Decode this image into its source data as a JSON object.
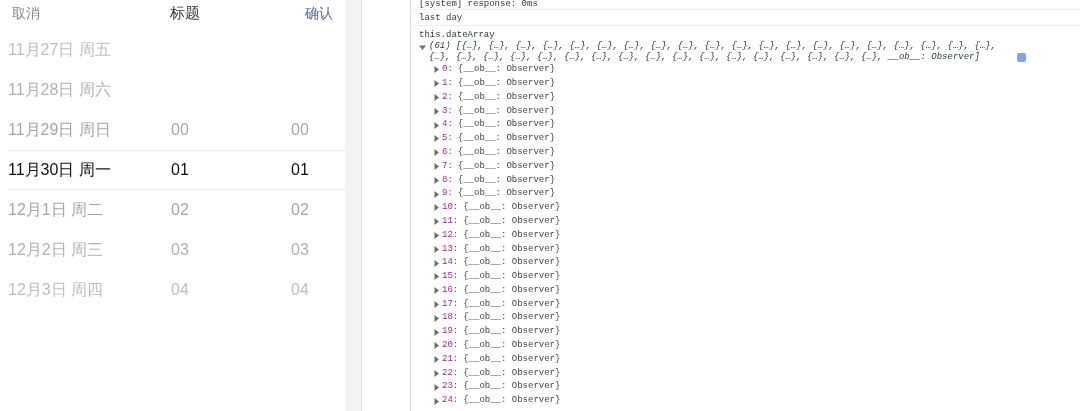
{
  "picker": {
    "cancel": "取消",
    "title": "标题",
    "confirm": "确认",
    "rows": [
      {
        "date": "11月27日 周五",
        "hour": "",
        "minute": "",
        "selected": false
      },
      {
        "date": "11月28日 周六",
        "hour": "",
        "minute": "",
        "selected": false
      },
      {
        "date": "11月29日 周日",
        "hour": "00",
        "minute": "00",
        "selected": false
      },
      {
        "date": "11月30日 周一",
        "hour": "01",
        "minute": "01",
        "selected": true
      },
      {
        "date": "12月1日 周二",
        "hour": "02",
        "minute": "02",
        "selected": false
      },
      {
        "date": "12月2日 周三",
        "hour": "03",
        "minute": "03",
        "selected": false
      },
      {
        "date": "12月3日 周四",
        "hour": "04",
        "minute": "04",
        "selected": false
      }
    ]
  },
  "console": {
    "messages": [
      {
        "text": "[system] response: 0ms"
      },
      {
        "text": "last day"
      }
    ],
    "log": {
      "label": "this.dateArray",
      "summary": "(61) [{…}, {…}, {…}, {…}, {…}, {…}, {…}, {…}, {…}, {…}, {…}, {…}, {…}, {…}, {…}, {…}, {…}, {…}, {…}, {…}, {…}, {…}, {…}, {…}, {…}, {…}, {…}, {…}, {…}, {…}, {…}, {…}, {…}, {…}, {…}, {…}, {…}, __ob__: Observer]",
      "expanded": true,
      "entries": [
        {
          "key": "0:",
          "value": "{__ob__: Observer}",
          "expanded": false
        },
        {
          "key": "1:",
          "value": "{__ob__: Observer}",
          "expanded": false
        },
        {
          "key": "2:",
          "value": "{__ob__: Observer}",
          "expanded": false
        },
        {
          "key": "3:",
          "value": "{__ob__: Observer}",
          "expanded": false
        },
        {
          "key": "4:",
          "value": "{__ob__: Observer}",
          "expanded": false
        },
        {
          "key": "5:",
          "value": "{__ob__: Observer}",
          "expanded": false
        },
        {
          "key": "6:",
          "value": "{__ob__: Observer}",
          "expanded": false
        },
        {
          "key": "7:",
          "value": "{__ob__: Observer}",
          "expanded": false
        },
        {
          "key": "8:",
          "value": "{__ob__: Observer}",
          "expanded": false
        },
        {
          "key": "9:",
          "value": "{__ob__: Observer}",
          "expanded": false
        },
        {
          "key": "10:",
          "value": "{__ob__: Observer}",
          "expanded": false
        },
        {
          "key": "11:",
          "value": "{__ob__: Observer}",
          "expanded": false
        },
        {
          "key": "12:",
          "value": "{__ob__: Observer}",
          "expanded": false
        },
        {
          "key": "13:",
          "value": "{__ob__: Observer}",
          "expanded": false
        },
        {
          "key": "14:",
          "value": "{__ob__: Observer}",
          "expanded": false
        },
        {
          "key": "15:",
          "value": "{__ob__: Observer}",
          "expanded": false
        },
        {
          "key": "16:",
          "value": "{__ob__: Observer}",
          "expanded": false
        },
        {
          "key": "17:",
          "value": "{__ob__: Observer}",
          "expanded": false
        },
        {
          "key": "18:",
          "value": "{__ob__: Observer}",
          "expanded": false
        },
        {
          "key": "19:",
          "value": "{__ob__: Observer}",
          "expanded": false
        },
        {
          "key": "20:",
          "value": "{__ob__: Observer}",
          "expanded": false
        },
        {
          "key": "21:",
          "value": "{__ob__: Observer}",
          "expanded": false
        },
        {
          "key": "22:",
          "value": "{__ob__: Observer}",
          "expanded": false
        },
        {
          "key": "23:",
          "value": "{__ob__: Observer}",
          "expanded": false
        },
        {
          "key": "24:",
          "value": "{__ob__: Observer}",
          "expanded": false
        }
      ]
    }
  }
}
